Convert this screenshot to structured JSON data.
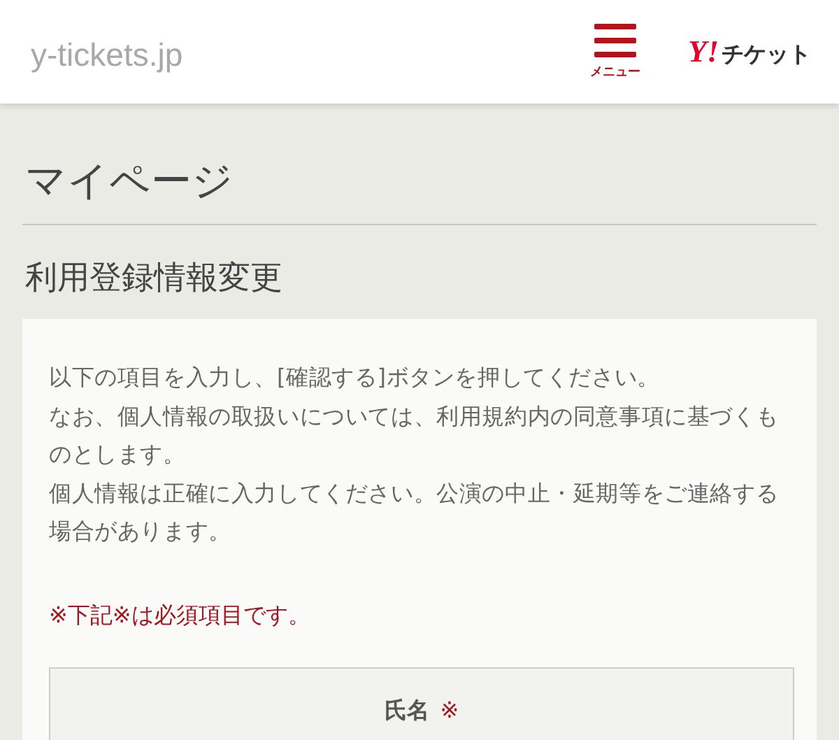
{
  "header": {
    "site": "y-tickets.jp",
    "menu_label": "メニュー",
    "logo_mark": "Y!",
    "logo_text": "チケット"
  },
  "page_title": "マイページ",
  "section_title": "利用登録情報変更",
  "intro": [
    "以下の項目を入力し、[確認する]ボタンを押してください。",
    "なお、個人情報の取扱いについては、利用規約内の同意事項に基づくものとします。",
    "個人情報は正確に入力してください。公演の中止・延期等をご連絡する場合があります。"
  ],
  "required_note": "※下記※は必須項目です。",
  "fields": [
    {
      "label": "氏名",
      "required_mark": "※"
    }
  ]
}
